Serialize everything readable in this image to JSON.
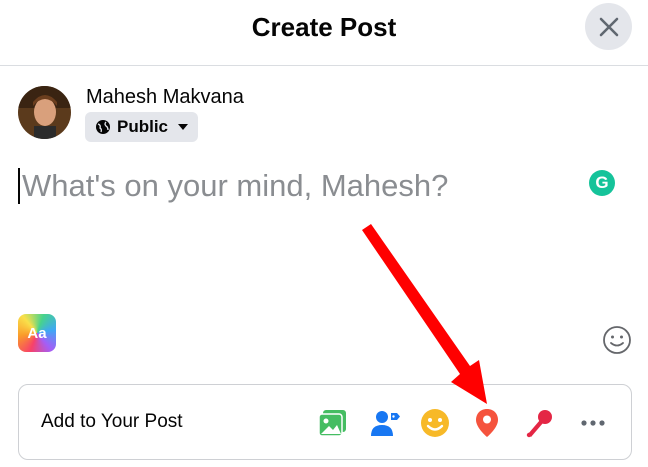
{
  "header": {
    "title": "Create Post"
  },
  "user": {
    "name": "Mahesh Makvana",
    "privacy_label": "Public"
  },
  "composer": {
    "placeholder": "What's on your mind, Mahesh?"
  },
  "text_format": {
    "label": "Aa"
  },
  "add_to_post": {
    "label": "Add to Your Post",
    "icons": [
      "photo-video-icon",
      "tag-people-icon",
      "feeling-activity-icon",
      "check-in-location-icon",
      "host-qa-microphone-icon",
      "more-options-icon"
    ]
  },
  "colors": {
    "photo": "#45bd62",
    "tag": "#1877f2",
    "feeling": "#f7b928",
    "location": "#f5533d",
    "microphone": "#e42645",
    "annotation_arrow": "#ff0000"
  }
}
